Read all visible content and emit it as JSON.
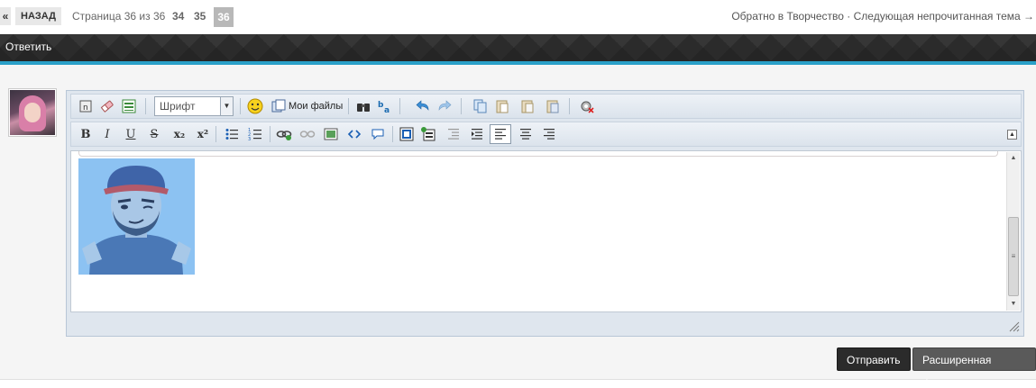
{
  "pagination": {
    "first_label": "«",
    "back_label": "НАЗАД",
    "page_info": "Страница 36 из 36",
    "pages": [
      "34",
      "35"
    ],
    "current_page": "36"
  },
  "top_links": {
    "back_to_forum": "Обратно в Творчество",
    "separator": "·",
    "next_unread": "Следующая непрочитанная тема →"
  },
  "header": {
    "title": "Ответить"
  },
  "editor": {
    "font_select_value": "Шрифт",
    "my_files_label": "Мои файлы",
    "toolbar_row1_icons": [
      "source-icon",
      "eraser-icon",
      "paragraph-icon",
      "emoticon-icon",
      "my-files-icon",
      "binoculars-icon",
      "spellcheck-icon",
      "undo-icon",
      "redo-icon",
      "copy-icon",
      "paste-icon",
      "paste-text-icon",
      "paste-word-icon",
      "settings-icon"
    ],
    "toolbar_row2_icons": [
      "bold-icon",
      "italic-icon",
      "underline-icon",
      "strikethrough-icon",
      "subscript-icon",
      "superscript-icon",
      "bulleted-list-icon",
      "numbered-list-icon",
      "link-icon",
      "unlink-icon",
      "image-icon",
      "code-icon",
      "quote-icon",
      "spoiler-icon",
      "media-icon",
      "outdent-icon",
      "indent-icon",
      "align-left-icon",
      "align-center-icon",
      "align-right-icon"
    ],
    "glyphs": {
      "bold": "B",
      "italic": "I",
      "underline": "U",
      "strike": "S",
      "sub": "x₂",
      "sup": "x²"
    },
    "active_alignment": "left"
  },
  "actions": {
    "send_label": "Отправить",
    "advanced_label": "Расширенная форма"
  },
  "colors": {
    "accent": "#2aa0c8",
    "dark_bar": "#2b2b2b",
    "editor_bg": "#dfe6ee"
  }
}
